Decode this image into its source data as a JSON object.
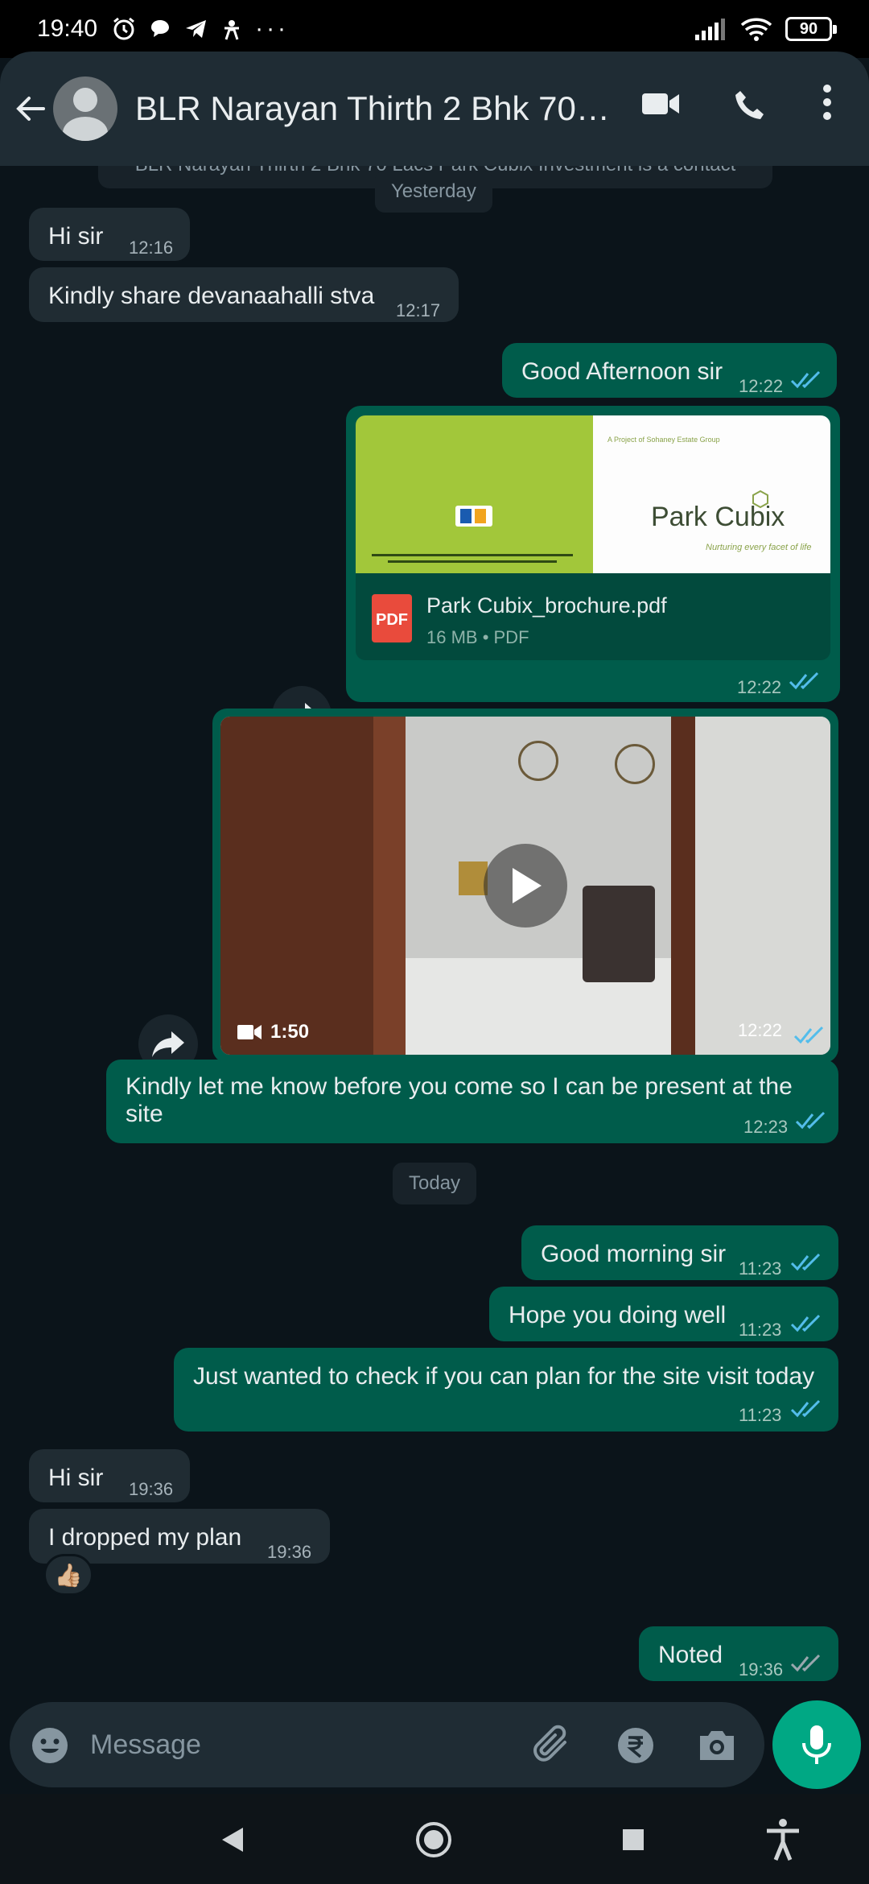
{
  "status_bar": {
    "time": "19:40",
    "battery": "90"
  },
  "header": {
    "title": "BLR Narayan Thirth 2 Bhk 70 Lacs",
    "title_display": "BLR Narayan Thirth 2 Bhk 70…"
  },
  "system_banner": "BLR Narayan Thirth 2 Bhk 70 Lacs Park Cubix Investment is a contact",
  "dates": {
    "yesterday": "Yesterday",
    "today": "Today"
  },
  "messages": {
    "m1": {
      "text": "Hi sir",
      "time": "12:16"
    },
    "m2": {
      "text": "Kindly share devanaahalli stva",
      "time": "12:17"
    },
    "m3": {
      "text": "Good Afternoon sir",
      "time": "12:22"
    },
    "doc": {
      "file_name": "Park Cubix_brochure.pdf",
      "meta": "16 MB • PDF",
      "time": "12:22",
      "icon_label": "PDF",
      "thumb_brand": "Park Cubix",
      "thumb_tagline": "Nurturing every facet of life",
      "thumb_top": "A Project of Sohaney Estate Group"
    },
    "video": {
      "duration": "1:50",
      "time": "12:22"
    },
    "m4": {
      "line1": "Kindly let me know before you come so I can be present at the",
      "line2": "site",
      "time": "12:23"
    },
    "m5": {
      "text": "Good morning sir",
      "time": "11:23"
    },
    "m6": {
      "text": "Hope you doing well",
      "time": "11:23"
    },
    "m7": {
      "text": "Just wanted to check if you can plan for the site visit today",
      "time": "11:23"
    },
    "m8": {
      "text": "Hi sir",
      "time": "19:36"
    },
    "m9": {
      "text": "I dropped my plan",
      "time": "19:36",
      "reaction": "👍🏼"
    },
    "m10": {
      "text": "Noted",
      "time": "19:36"
    }
  },
  "input": {
    "placeholder": "Message"
  },
  "colors": {
    "background": "#0b141a",
    "incoming": "#202c33",
    "outgoing": "#005c4b",
    "accent": "#00a884",
    "read_ticks": "#53bdeb"
  }
}
